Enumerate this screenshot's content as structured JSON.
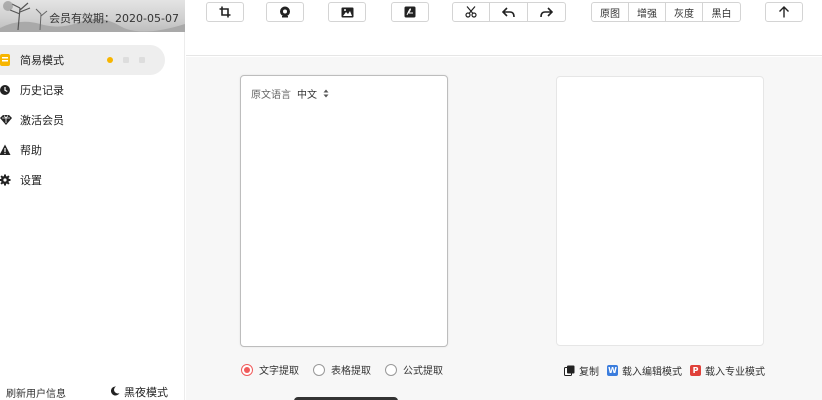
{
  "sidebar": {
    "expiry_label": "会员有效期：2020-05-07",
    "items": [
      {
        "label": "简易模式",
        "icon": "simple-mode-icon"
      },
      {
        "label": "历史记录",
        "icon": "clock-icon"
      },
      {
        "label": "激活会员",
        "icon": "diamond-icon"
      },
      {
        "label": "帮助",
        "icon": "warning-icon"
      },
      {
        "label": "设置",
        "icon": "gear-icon"
      }
    ],
    "refresh_label": "刷新用户信息",
    "night_label": "黑夜模式"
  },
  "toolbar": {
    "filters": [
      "原图",
      "增强",
      "灰度",
      "黑白"
    ]
  },
  "main": {
    "source_lang_label": "原文语言",
    "source_lang_value": "中文",
    "modes": [
      {
        "label": "文字提取",
        "selected": true
      },
      {
        "label": "表格提取",
        "selected": false
      },
      {
        "label": "公式提取",
        "selected": false
      }
    ],
    "actions": {
      "copy": "复制",
      "edit_mode": "载入编辑模式",
      "pro_mode": "载入专业模式",
      "edit_badge": "W",
      "pro_badge": "P"
    }
  },
  "colors": {
    "accent": "#f7b500",
    "radio_selected": "#f05b5b",
    "word_blue": "#3b7ddd",
    "pdf_red": "#e0413a"
  }
}
